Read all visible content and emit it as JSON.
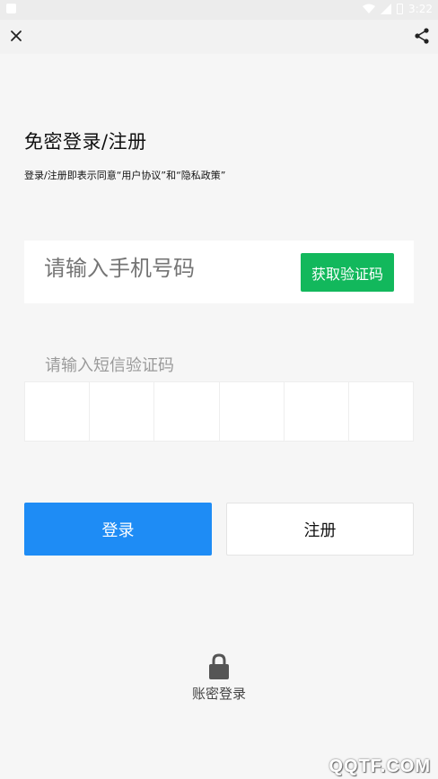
{
  "status_bar": {
    "time": "3:22"
  },
  "title": "免密登录/注册",
  "agreement_text": "登录/注册即表示同意“用户协议”和“隐私政策”",
  "phone": {
    "placeholder": "请输入手机号码",
    "get_code_label": "获取验证码"
  },
  "sms": {
    "label": "请输入短信验证码",
    "box_count": 6
  },
  "actions": {
    "login_label": "登录",
    "register_label": "注册"
  },
  "account_login": {
    "icon": "lock-icon",
    "label": "账密登录"
  },
  "watermark": "QQTF.COM",
  "colors": {
    "primary_blue": "#1e8cf5",
    "green": "#12b85c",
    "background": "#f6f6f6"
  }
}
